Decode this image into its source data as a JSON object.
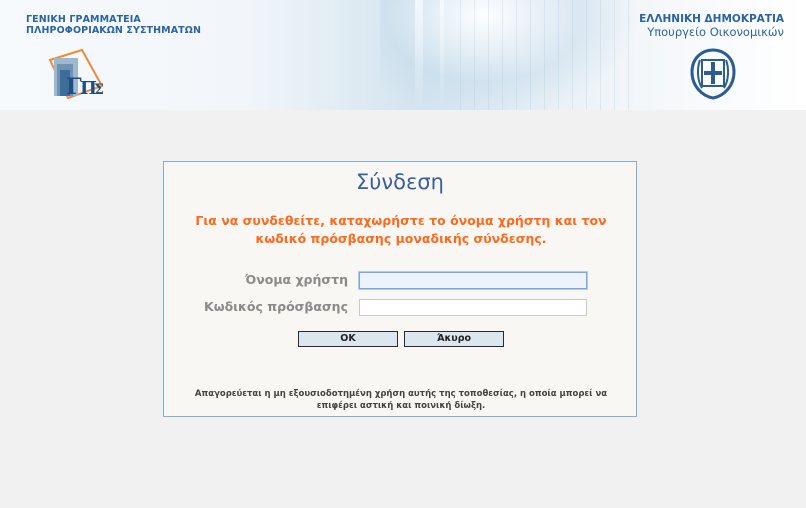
{
  "header": {
    "org_left_line1": "ΓΕΝΙΚΗ ΓΡΑΜΜΑΤΕΙΑ",
    "org_left_line2": "ΠΛΗΡΟΦΟΡΙΑΚΩΝ ΣΥΣΤΗΜΑΤΩΝ",
    "org_right_line1": "ΕΛΛΗΝΙΚΗ ΔΗΜΟΚΡΑΤΙΑ",
    "org_right_line2": "Υπουργείο Οικονομικών",
    "left_logo_icon": "gsis-logo-icon",
    "right_logo_icon": "greek-coat-of-arms-icon"
  },
  "login": {
    "title": "Σύνδεση",
    "message": "Για να συνδεθείτε, καταχωρήστε το όνομα χρήστη και τον κωδικό πρόσβασης μοναδικής σύνδεσης.",
    "username_label": "Όνομα χρήστη",
    "username_value": "",
    "password_label": "Κωδικός πρόσβασης",
    "password_value": "",
    "ok_label": "OK",
    "cancel_label": "Άκυρο",
    "warning": "Απαγορεύεται η μη εξουσιοδοτημένη χρήση αυτής της τοποθεσίας, η οποία μπορεί να επιφέρει αστική και ποινική δίωξη."
  },
  "colors": {
    "title": "#3a5f9a",
    "message": "#ff6a1a",
    "header_text": "#2a63a4",
    "box_border": "#7fb0c7"
  }
}
